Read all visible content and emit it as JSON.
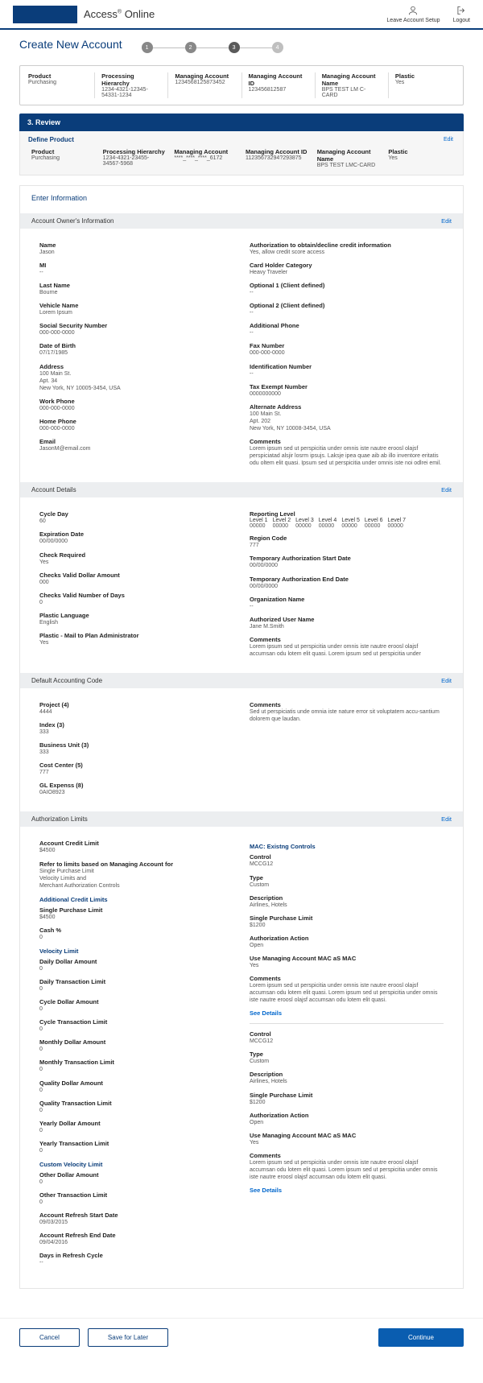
{
  "header": {
    "brand": "Access",
    "brand_suffix": " Online",
    "leave": "Leave Account Setup",
    "logout": "Logout"
  },
  "title": "Create New Account",
  "steps": [
    "1",
    "2",
    "3",
    "4"
  ],
  "summary": [
    {
      "l": "Product",
      "v": "Purchasing"
    },
    {
      "l": "Processing Hierarchy",
      "v": "1234-4321-12345-54331-1234"
    },
    {
      "l": "Managing Account",
      "v": "1234568125873452"
    },
    {
      "l": "Managing Account ID",
      "v": "123456812587"
    },
    {
      "l": "Managing Account Name",
      "v": "BPS TEST LM C-CARD"
    },
    {
      "l": "Plastic",
      "v": "Yes"
    }
  ],
  "step_hdr": "3.  Review",
  "define_product": {
    "title": "Define Product",
    "edit": "Edit",
    "items": [
      {
        "l": "Product",
        "v": "Purchasing"
      },
      {
        "l": "Processing Hierarchy",
        "v": "1234-4321-23455-34567-5968"
      },
      {
        "l": "Managing Account",
        "v": "****_****_****_6172"
      },
      {
        "l": "Managing Account ID",
        "v": "11235673294?293875"
      },
      {
        "l": "Managing Account Name",
        "v": "BPS TEST LMC-CARD"
      },
      {
        "l": "Plastic",
        "v": "Yes"
      }
    ]
  },
  "enter_info": "Enter Information",
  "owner": {
    "title": "Account Owner's Information",
    "edit": "Edit",
    "left": [
      {
        "k": "Name",
        "v": "Jason"
      },
      {
        "k": "MI",
        "v": "--"
      },
      {
        "k": "Last Name",
        "v": "Bourne"
      },
      {
        "k": "Vehicle Name",
        "v": "Lorem Ipsum"
      },
      {
        "k": "Social Security Number",
        "v": "000-000-0000"
      },
      {
        "k": "Date of Birth",
        "v": "07/17/1985"
      },
      {
        "k": "Address",
        "v": "100 Main St.\nApt. 34\nNew York, NY 10005-3454, USA"
      },
      {
        "k": "Work Phone",
        "v": "000-000-0000"
      },
      {
        "k": "Home Phone",
        "v": "000-000-0000"
      },
      {
        "k": "Email",
        "v": "JasonM@email.com"
      }
    ],
    "right": [
      {
        "k": "Authorization to obtain/decline credit information",
        "v": "Yes, allow credit score access"
      },
      {
        "k": "Card Holder Category",
        "v": "Heavy Traveler"
      },
      {
        "k": "Optional 1 (Client defined)",
        "v": "--"
      },
      {
        "k": "Optional 2 (Client defined)",
        "v": "--"
      },
      {
        "k": "Additional Phone",
        "v": "--"
      },
      {
        "k": "Fax Number",
        "v": "000-000-0000"
      },
      {
        "k": "Identification Number",
        "v": "--"
      },
      {
        "k": "Tax Exempt Number",
        "v": "0000000000"
      },
      {
        "k": "Alternate Address",
        "v": "100 Main St.\nApt. 202\nNew York, NY 10008-3454, USA"
      },
      {
        "k": "Comments",
        "v": "Lorem ipsum sed ut perspicitia under omnis iste nautre eroosl olajsf perspiciatad alsjir losrm ipsujs. Laksje ipea quae aib ab illo inventore eritatis odu oltem elit quasi.  Ipsum sed ut perspicitia under omnis iste noi odlrei emil."
      }
    ]
  },
  "details": {
    "title": "Account Details",
    "edit": "Edit",
    "left": [
      {
        "k": "Cycle Day",
        "v": "60"
      },
      {
        "k": "Expiration Date",
        "v": "00/00/0000"
      },
      {
        "k": "Check Required",
        "v": "Yes"
      },
      {
        "k": "Checks Valid Dollar Amount",
        "v": "000"
      },
      {
        "k": "Checks Valid Number of Days",
        "v": "0"
      },
      {
        "k": "Plastic Language",
        "v": "English"
      },
      {
        "k": "Plastic - Mail to Plan Administrator",
        "v": "Yes"
      }
    ],
    "reporting": {
      "k": "Reporting Level",
      "levels": [
        {
          "l": "Level 1",
          "v": "00000"
        },
        {
          "l": "Level 2",
          "v": "00000"
        },
        {
          "l": "Level 3",
          "v": "00000"
        },
        {
          "l": "Level 4",
          "v": "00000"
        },
        {
          "l": "Level 5",
          "v": "00000"
        },
        {
          "l": "Level 6",
          "v": "00000"
        },
        {
          "l": "Level 7",
          "v": "00000"
        }
      ]
    },
    "right": [
      {
        "k": "Region Code",
        "v": "777"
      },
      {
        "k": "Temporary Authorization Start Date",
        "v": "00/00/0000"
      },
      {
        "k": "Temporary Authorization End Date",
        "v": "00/00/0000"
      },
      {
        "k": "Organization Name",
        "v": "--"
      },
      {
        "k": "Authorized User Name",
        "v": "Jane M.Smith"
      },
      {
        "k": "Comments",
        "v": "Lorem ipsum sed ut perspicitia under omnis iste nautre eroosl olajsf accumsan odu lotem elit quasi.  Lorem ipsum sed ut perspicitia under"
      }
    ]
  },
  "dac": {
    "title": "Default Accounting Code",
    "edit": "Edit",
    "left": [
      {
        "k": "Project (4)",
        "v": "4444"
      },
      {
        "k": "Index (3)",
        "v": "333"
      },
      {
        "k": "Business Unit (3)",
        "v": "333"
      },
      {
        "k": "Cost Center (5)",
        "v": "777"
      },
      {
        "k": "GL Expenss (8)",
        "v": "0AIO8923"
      }
    ],
    "right": [
      {
        "k": "Comments",
        "v": "Sed ut perspiciatis unde omnia iste nature error sit voluptatem accu-santium dolorem que laudan."
      }
    ]
  },
  "auth": {
    "title": "Authorization Limits",
    "edit": "Edit",
    "left": [
      {
        "k": "Account Credit Limit",
        "v": "$4500"
      },
      {
        "k": "Refer to limits based on Managing Account for",
        "v": "Single Purchase Limit\nVelocity Limits and\nMerchant Authorization Controls"
      }
    ],
    "addl_title": "Additional Credit Limits",
    "addl": [
      {
        "k": "Single Purchase Limit",
        "v": "$4500"
      },
      {
        "k": "Cash %",
        "v": "0"
      }
    ],
    "vel_title": "Velocity Limit",
    "vel": [
      {
        "k": "Daily Dollar Amount",
        "v": "0"
      },
      {
        "k": "Daily Transaction Limit",
        "v": "0"
      },
      {
        "k": "Cycle Dollar Amount",
        "v": "0"
      },
      {
        "k": "Cycle Transaction Limit",
        "v": "0"
      },
      {
        "k": "Monthly Dollar Amount",
        "v": "0"
      },
      {
        "k": "Monthly Transaction Limit",
        "v": "0"
      },
      {
        "k": "Quality Dollar Amount",
        "v": "0"
      },
      {
        "k": "Quality Transaction Limit",
        "v": "0"
      },
      {
        "k": "Yearly Dollar Amount",
        "v": "0"
      },
      {
        "k": "Yearly Transaction Limit",
        "v": "0"
      }
    ],
    "custom_title": "Custom Velocity Limit",
    "custom": [
      {
        "k": "Other Dollar Amount",
        "v": "0"
      },
      {
        "k": "Other Transaction Limit",
        "v": "0"
      },
      {
        "k": "Account Refresh Start Date",
        "v": "09/03/2015"
      },
      {
        "k": "Account Refresh End Date",
        "v": "09/04/2016"
      },
      {
        "k": "Days in Refresh Cycle",
        "v": "--"
      }
    ],
    "mac_title": "MAC: Existng Controls",
    "mac": [
      {
        "fields": [
          {
            "k": "Control",
            "v": "MCCG12"
          },
          {
            "k": "Type",
            "v": "Custom"
          },
          {
            "k": "Description",
            "v": "Airlines, Hotels"
          },
          {
            "k": "Single Purchase Limit",
            "v": "$1200"
          },
          {
            "k": "Authorization Action",
            "v": "Open"
          },
          {
            "k": "Use Managing Account MAC aS MAC",
            "v": "Yes"
          },
          {
            "k": "Comments",
            "v": "Lorem ipsum sed ut perspicitia under omnis iste nautre eroosl olajsf accumsan odu lotem elit quasi.  Lorem ipsum sed ut perspicitia under omnis iste nautre eroosl olajsf accumsan odu lotem elit quasi."
          }
        ],
        "see": "See Details"
      },
      {
        "fields": [
          {
            "k": "Control",
            "v": "MCCG12"
          },
          {
            "k": "Type",
            "v": "Custom"
          },
          {
            "k": "Description",
            "v": "Airlines, Hotels"
          },
          {
            "k": "Single Purchase Limit",
            "v": "$1200"
          },
          {
            "k": "Authorization Action",
            "v": "Open"
          },
          {
            "k": "Use Managing Account MAC aS MAC",
            "v": "Yes"
          },
          {
            "k": "Comments",
            "v": "Lorem ipsum sed ut perspicitia under omnis iste nautre eroosl olajsf accumsan odu lotem elit quasi.  Lorem ipsum sed ut perspicitia under omnis iste nautre eroosl olajsf accumsan odu lotem elit quasi."
          }
        ],
        "see": "See Details"
      }
    ]
  },
  "footer": {
    "cancel": "Cancel",
    "save": "Save for Later",
    "continue": "Continue"
  }
}
